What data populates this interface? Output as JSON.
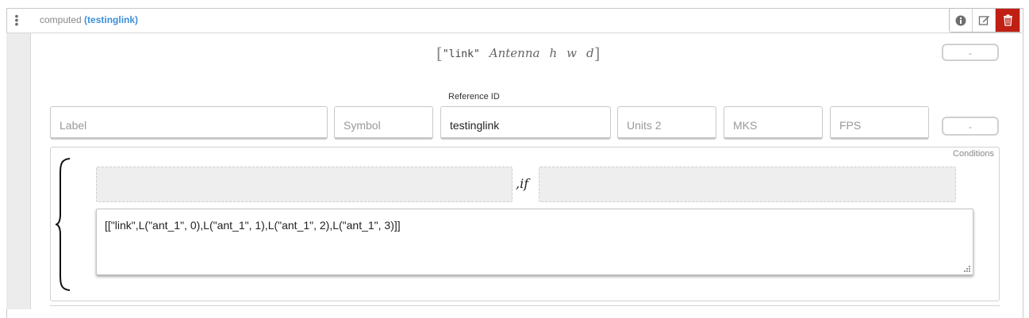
{
  "header": {
    "type_label": "computed",
    "name_label": "(testinglink)",
    "icons": [
      "info-icon",
      "edit-icon",
      "trash-icon"
    ]
  },
  "math_preview": {
    "string": "\"link\"",
    "terms": [
      "Antenna",
      "h",
      "w",
      "d"
    ]
  },
  "minus_label": "-",
  "reference": {
    "label": "Reference ID"
  },
  "fields": {
    "label_placeholder": "Label",
    "symbol_placeholder": "Symbol",
    "reference_value": "testinglink",
    "units2_placeholder": "Units 2",
    "mks_placeholder": "MKS",
    "fps_placeholder": "FPS"
  },
  "conditions": {
    "label": "Conditions",
    "if_text": ",if",
    "code": "[[\"link\",L(\"ant_1\", 0),L(\"ant_1\", 1),L(\"ant_1\", 2),L(\"ant_1\", 3)]]"
  },
  "colors": {
    "link_blue": "#3a8fd8",
    "delete_red": "#c01f14"
  }
}
